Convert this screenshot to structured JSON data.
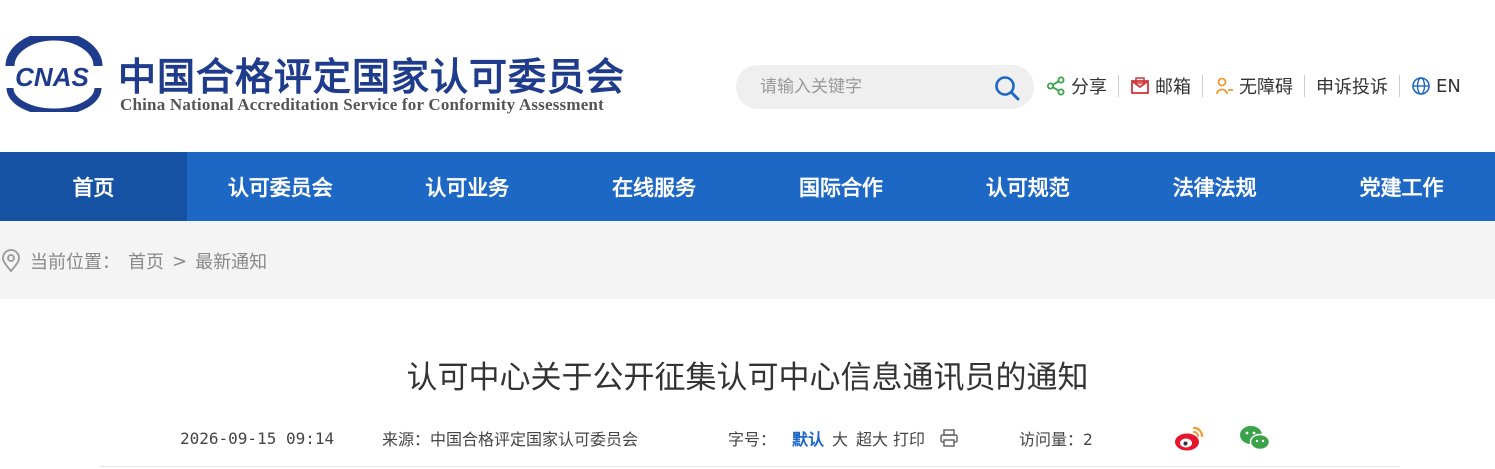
{
  "header": {
    "logo_text": "CNAS",
    "brand_cn": "中国合格评定国家认可委员会",
    "brand_en": "China National Accreditation Service for Conformity Assessment",
    "search": {
      "placeholder": "请输入关键字"
    },
    "tools": [
      {
        "label": "分享",
        "icon": "share-icon"
      },
      {
        "label": "邮箱",
        "icon": "mail-icon"
      },
      {
        "label": "无障碍",
        "icon": "accessibility-icon"
      },
      {
        "label": "申诉投诉",
        "icon": ""
      },
      {
        "label": "EN",
        "icon": "globe-icon"
      }
    ]
  },
  "nav": {
    "items": [
      {
        "label": "首页",
        "active": true
      },
      {
        "label": "认可委员会"
      },
      {
        "label": "认可业务"
      },
      {
        "label": "在线服务"
      },
      {
        "label": "国际合作"
      },
      {
        "label": "认可规范"
      },
      {
        "label": "法律法规"
      },
      {
        "label": "党建工作"
      }
    ]
  },
  "breadcrumb": {
    "prefix": "当前位置：",
    "home": "首页",
    "separator": ">",
    "current": "最新通知"
  },
  "article": {
    "title": "认可中心关于公开征集认可中心信息通讯员的通知",
    "date": "2026-09-15 09:14",
    "source_label": "来源：",
    "source": "中国合格评定国家认可委员会",
    "font_size_label": "字号：",
    "font_sizes": [
      "默认",
      "大",
      "超大"
    ],
    "print_label": "打印",
    "visits_label": "访问量：",
    "visits": "2"
  },
  "colors": {
    "brand_blue": "#1f3b8c",
    "nav_blue": "#1d67c5",
    "nav_active": "#1552a3",
    "share_green": "#3aa34a",
    "mail_red": "#d0363b",
    "accessibility_orange": "#f29a2e"
  }
}
